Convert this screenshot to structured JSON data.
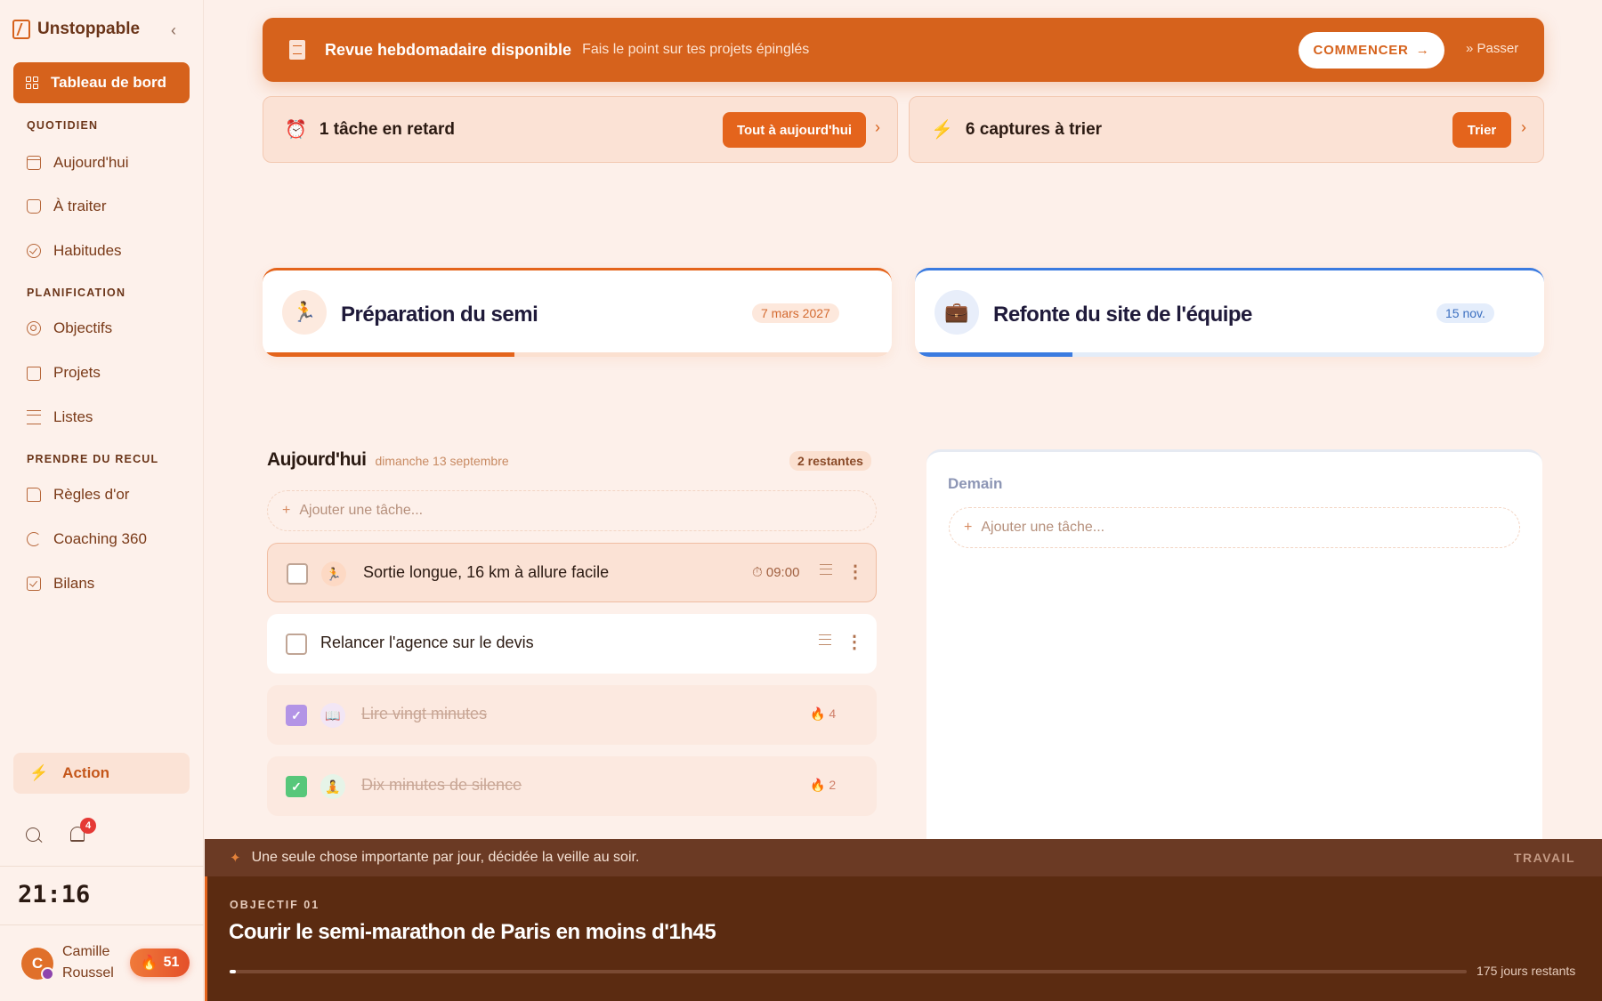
{
  "app": {
    "name": "Unstoppable"
  },
  "sidebar": {
    "active": "Tableau de bord",
    "sections": [
      {
        "label": "QUOTIDIEN",
        "items": [
          "Aujourd'hui",
          "À traiter",
          "Habitudes"
        ]
      },
      {
        "label": "PLANIFICATION",
        "items": [
          "Objectifs",
          "Projets",
          "Listes"
        ]
      },
      {
        "label": "PRENDRE DU RECUL",
        "items": [
          "Règles d'or",
          "Coaching 360",
          "Bilans"
        ]
      }
    ],
    "action_label": "Action",
    "notifications_count": "4",
    "clock": "21:16",
    "user": {
      "initial": "C",
      "name": "Camille Roussel",
      "streak": "51"
    }
  },
  "banner": {
    "title": "Revue hebdomadaire disponible",
    "subtitle": "Fais le point sur tes projets épinglés",
    "cta": "COMMENCER",
    "skip": "Passer"
  },
  "alerts": [
    {
      "text": "1 tâche en retard",
      "button": "Tout à aujourd'hui",
      "icon": "alarm-icon"
    },
    {
      "text": "6 captures à trier",
      "button": "Trier",
      "icon": "bolt-icon"
    }
  ],
  "goals": [
    {
      "title": "Préparation du semi",
      "date": "7 mars 2027",
      "progress": 0.4,
      "accent": "#e4641c"
    },
    {
      "title": "Refonte du site de l'équipe",
      "date": "15 nov.",
      "progress": 0.25,
      "accent": "#3b7be0"
    }
  ],
  "today": {
    "title": "Aujourd'hui",
    "date": "dimanche 13 septembre",
    "remaining": "2 restantes",
    "add_placeholder": "Ajouter une tâche...",
    "tasks": [
      {
        "label": "Sortie longue, 16 km à allure facile",
        "time": "09:00",
        "done": false,
        "emoji": "runner"
      },
      {
        "label": "Relancer l'agence sur le devis",
        "done": false
      },
      {
        "label": "Lire vingt minutes",
        "done": true,
        "streak": "4",
        "emoji": "book"
      },
      {
        "label": "Dix minutes de silence",
        "done": true,
        "streak": "2",
        "emoji": "meditation"
      }
    ]
  },
  "tomorrow": {
    "title": "Demain",
    "add_placeholder": "Ajouter une tâche..."
  },
  "footer": {
    "quote": "Une seule chose importante par jour, décidée la veille au soir.",
    "tag": "TRAVAIL",
    "objective_label": "OBJECTIF 01",
    "objective_title": "Courir le semi-marathon de Paris en moins d'1h45",
    "progress": 0.005,
    "days_left": "175 jours restants"
  }
}
